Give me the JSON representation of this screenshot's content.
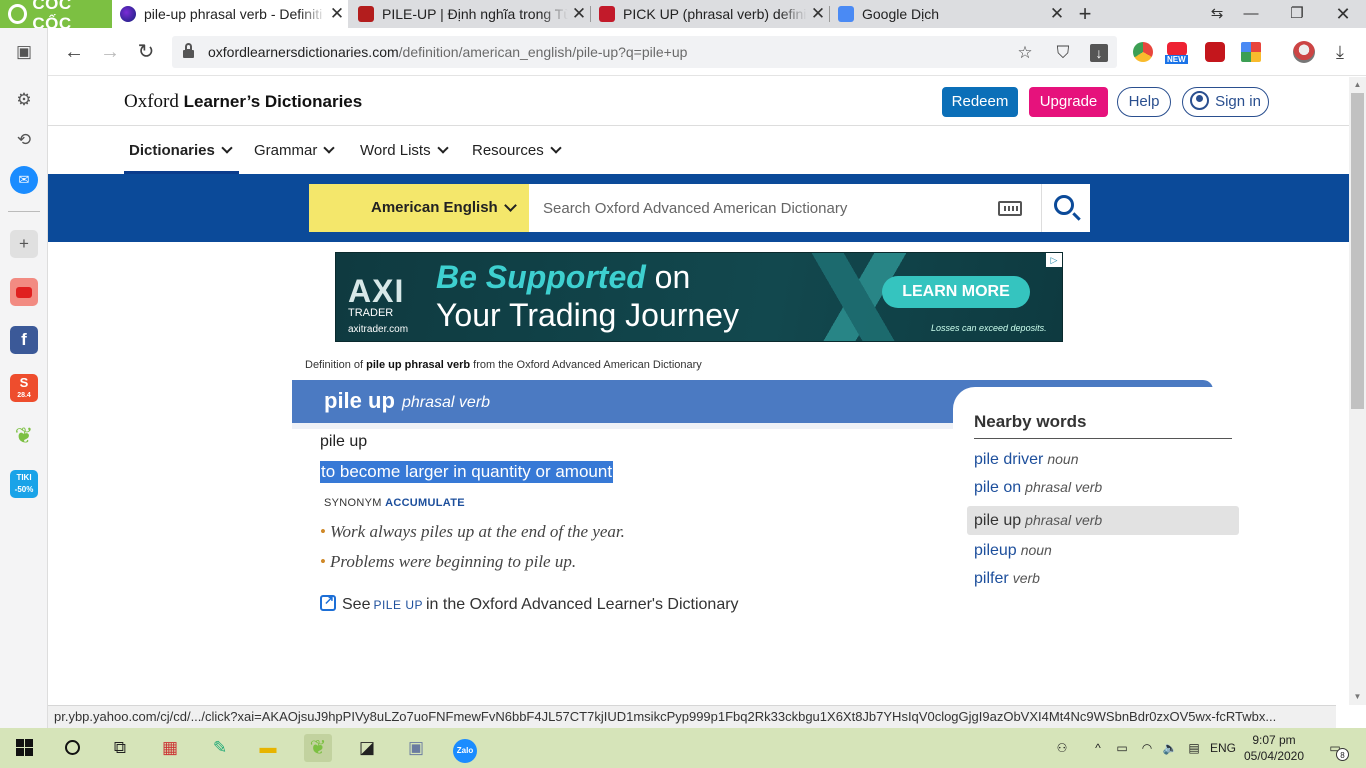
{
  "browser": {
    "brand": "CỐC CỐC",
    "tabs": [
      {
        "title": "pile-up phrasal verb - Definiti",
        "active": true
      },
      {
        "title": "PILE-UP | Định nghĩa trong Từ",
        "active": false
      },
      {
        "title": "PICK UP (phrasal verb) definit",
        "active": false
      },
      {
        "title": "Google Dịch",
        "active": false
      }
    ],
    "url_host": "oxfordlearnersdictionaries.com",
    "url_path": "/definition/american_english/pile-up?q=pile+up",
    "new_tab_label": "+",
    "new_badge": "NEW"
  },
  "sidebar": {
    "tiki_badge": "TIKI -50%",
    "shopee_badge": "28.4"
  },
  "site": {
    "logo_prefix": "Oxford",
    "logo_main": "Learner’s Dictionaries",
    "redeem": "Redeem",
    "upgrade": "Upgrade",
    "help": "Help",
    "signin": "Sign in",
    "menu": [
      "Dictionaries",
      "Grammar",
      "Word Lists",
      "Resources"
    ],
    "dict_selector": "American English",
    "search_placeholder": "Search Oxford Advanced American Dictionary"
  },
  "ad": {
    "brand": "AXI",
    "brand_sub": "TRADER",
    "brand_url": "axitrader.com",
    "line1_em": "Be Supported",
    "line1_rest": " on",
    "line2": "Your Trading Journey",
    "cta": "LEARN MORE",
    "disclaimer": "Losses can exceed deposits."
  },
  "entry": {
    "def_from_pre": "Definition of ",
    "def_from_bold": "pile up phrasal verb",
    "def_from_post": " from the Oxford Advanced American Dictionary",
    "headword": "pile up",
    "pos": "phrasal verb",
    "sense_headword": "pile up",
    "definition": "to become larger in quantity or amount",
    "synonym_label": "SYNONYM",
    "synonym": "ACCUMULATE",
    "examples": [
      "Work always piles up at the end of the year.",
      "Problems were beginning to pile up."
    ],
    "see_pre": "See",
    "see_word": "PILE UP",
    "see_post": "in the Oxford Advanced Learner's Dictionary"
  },
  "nearby": {
    "title": "Nearby words",
    "items": [
      {
        "word": "pile driver",
        "pos": "noun"
      },
      {
        "word": "pile on",
        "pos": "phrasal verb"
      },
      {
        "word": "pile up",
        "pos": "phrasal verb",
        "selected": true
      },
      {
        "word": "pileup",
        "pos": "noun"
      },
      {
        "word": "pilfer",
        "pos": "verb"
      }
    ]
  },
  "status_url": "pr.ybp.yahoo.com/cj/cd/.../click?xai=AKAOjsuJ9hpPIVy8uLZo7uoFNFmewFvN6bbF4JL57CT7kjIUD1msikcPyp999p1Fbq2Rk33ckbgu1X6Xt8Jb7YHsIqV0clogGjgI9azObVXI4Mt4Nc9WSbnBdr0zxOV5wx-fcRTwbx...",
  "taskbar": {
    "lang": "ENG",
    "time": "9:07 pm",
    "date": "05/04/2020",
    "notif_count": "8"
  },
  "colors": {
    "brand_green": "#7cc042",
    "oxford_blue": "#0b4a99",
    "redeem": "#0b6fb8",
    "upgrade": "#e6127c",
    "entry_head": "#4b7ac2",
    "selection": "#3779d6",
    "taskbar": "#d6e4b9"
  }
}
